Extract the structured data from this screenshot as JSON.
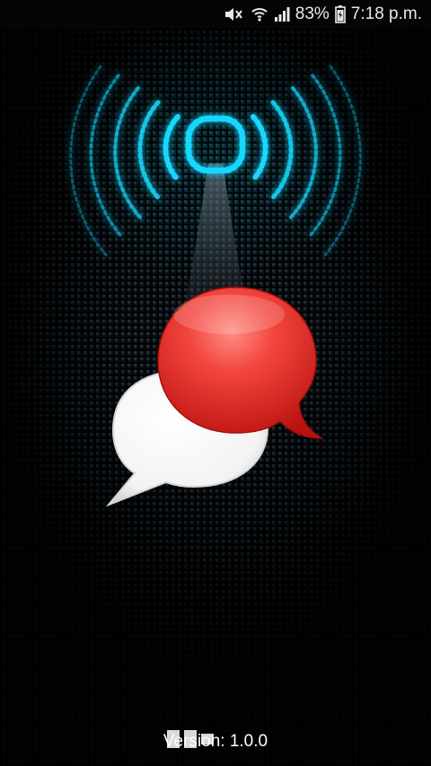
{
  "status_bar": {
    "battery_percent": "83%",
    "time": "7:18 p.m.",
    "icons": [
      "mute-icon",
      "wifi-icon",
      "signal-icon",
      "battery-icon"
    ]
  },
  "splash": {
    "version_text": "Version: 1.0.0",
    "colors": {
      "accent_cyan": "#19d8ff",
      "bubble_red": "#e8312d",
      "bubble_white": "#ffffff"
    }
  }
}
